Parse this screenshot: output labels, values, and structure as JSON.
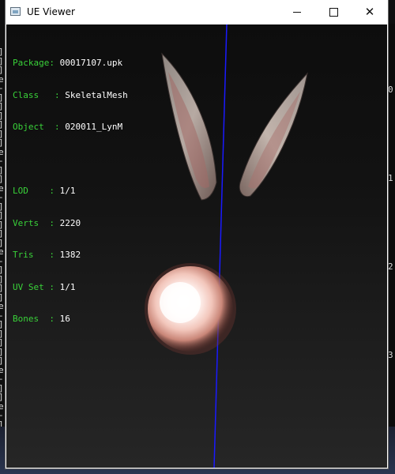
{
  "window": {
    "title": "UE Viewer",
    "controls": {
      "minimize": "Minimize",
      "maximize": "Maximize",
      "close": "Close"
    }
  },
  "mesh_info": {
    "package_key": "Package",
    "package": "00017107.upk",
    "class_key": "Class",
    "class": "SkeletalMesh",
    "object_key": "Object",
    "object": "020011_LynM",
    "lod_key": "LOD",
    "lod": "1/1",
    "verts_key": "Verts",
    "verts": "2220",
    "tris_key": "Tris",
    "tris": "1382",
    "uvset_key": "UV Set",
    "uvset": "1/1",
    "bones_key": "Bones",
    "bones": "16"
  },
  "background_console": {
    "left_lines": [
      "]",
      "]",
      "]",
      "e",
      "-",
      "]",
      "]",
      "]",
      "]",
      "]",
      "]",
      "e",
      "-",
      "]",
      "]",
      "e",
      "-",
      "]",
      "]",
      "]",
      "]",
      "]",
      "e",
      "-",
      "]",
      "]",
      "]",
      "]",
      "e",
      "-",
      "]",
      "]",
      "]",
      "]",
      "]",
      "e",
      "-",
      "]",
      "]",
      "e",
      "-",
      "]"
    ],
    "right_lines": [
      "0",
      "1",
      "2",
      "3"
    ]
  },
  "colors": {
    "label_green": "#39d139",
    "value_white": "#ffffff",
    "axis_blue": "#1a1aff"
  }
}
